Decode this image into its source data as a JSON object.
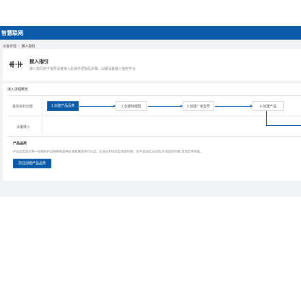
{
  "header": {
    "brand": "智慧联网"
  },
  "breadcrumb": {
    "items": [
      "设备管理",
      "接入指引"
    ],
    "separator": "/"
  },
  "guide": {
    "title": "接入指引",
    "description": "接入指引用于指导设备接入此操作逻辑及步骤，出期设备接入指控平台"
  },
  "process": {
    "title": "接入流程概览",
    "rows": [
      "基础资料创建",
      "设备接入"
    ],
    "steps": [
      "1.创建产品品类",
      "2.创建物模型",
      "3.创建厂家型号",
      "4.创建产品"
    ]
  },
  "section": {
    "title": "产品品类",
    "description": "产品品类是对某一领域的产品按照物品特征或者属性进行分类。此处应用域的监测类终端、空产品品类与动电-环境监控终端-温湿度传感器。",
    "button_label": "前往创建产品品类"
  },
  "colors": {
    "primary": "#0b5ba8",
    "background": "#f2f3f5"
  }
}
